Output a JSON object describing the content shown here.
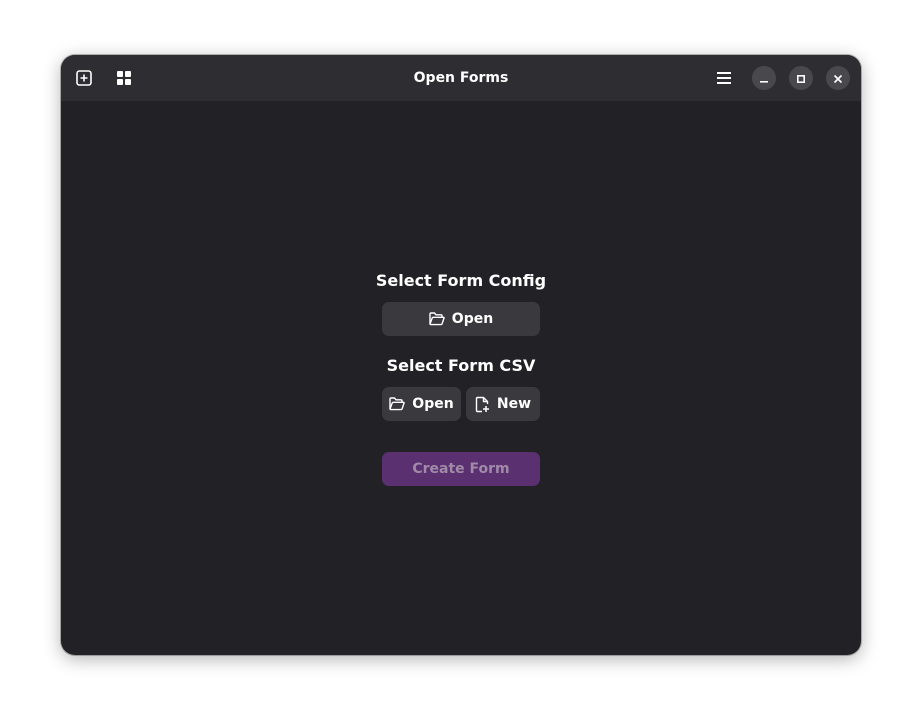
{
  "window": {
    "title": "Open Forms"
  },
  "headerbar": {
    "left_icons": [
      "new-tab-icon",
      "grid-icon"
    ],
    "right_icons": [
      "hamburger-menu-icon",
      "minimize-icon",
      "maximize-icon",
      "close-icon"
    ]
  },
  "config_section": {
    "label": "Select Form Config",
    "open_label": "Open",
    "open_icon": "folder-open-icon"
  },
  "csv_section": {
    "label": "Select Form CSV",
    "open_label": "Open",
    "open_icon": "folder-open-icon",
    "new_label": "New",
    "new_icon": "document-new-icon"
  },
  "create_button": {
    "label": "Create Form",
    "enabled": false
  },
  "colors": {
    "window_bg": "#222226",
    "headerbar_bg": "#2e2e32",
    "button_bg": "#3a3a3e",
    "accent_disabled_bg": "#5a3070",
    "accent_disabled_text": "#a08aa8"
  }
}
